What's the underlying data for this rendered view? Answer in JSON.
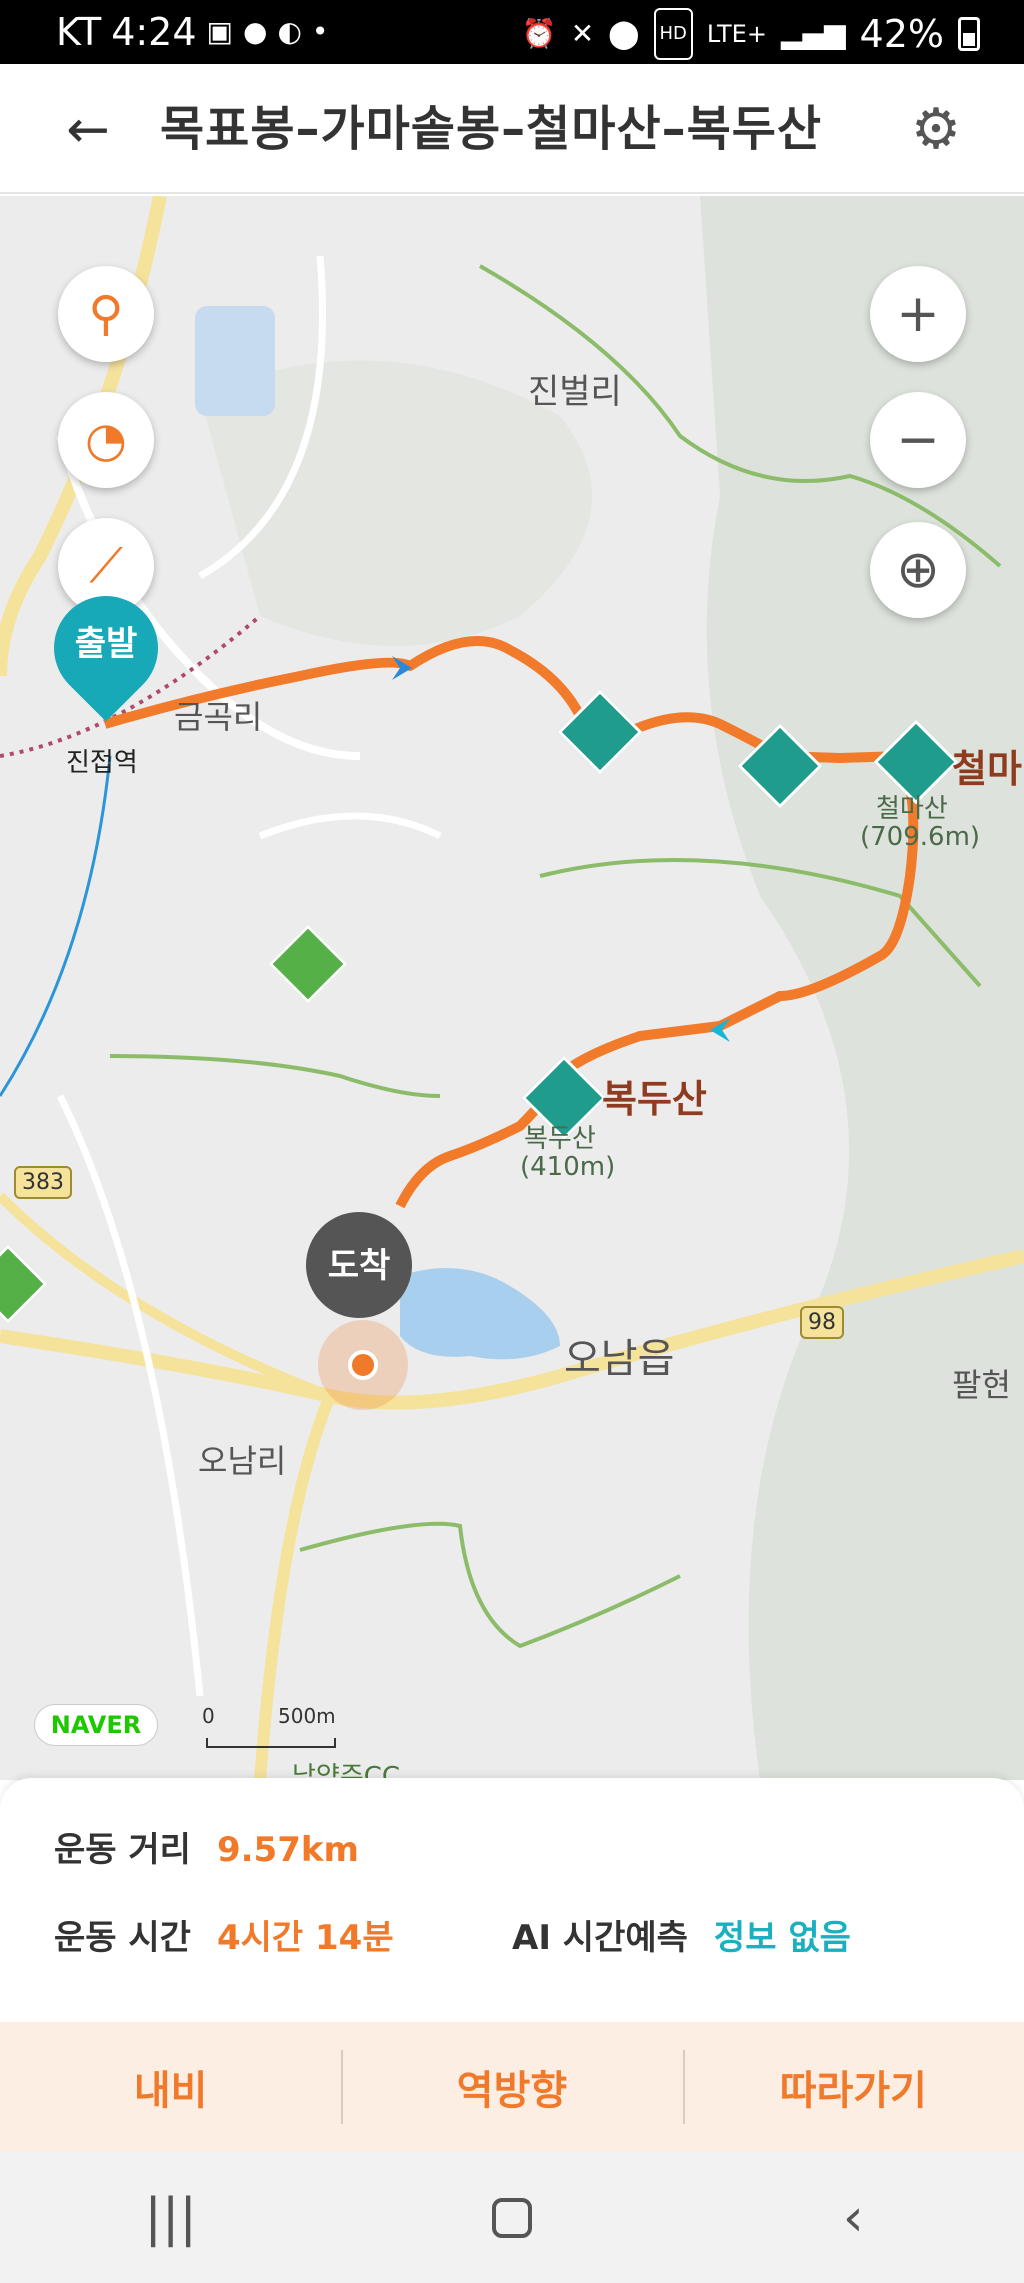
{
  "status_bar": {
    "carrier": "KT",
    "time": "4:24",
    "network": "LTE+",
    "battery_percent": "42%",
    "battery_level": 0.42,
    "left_icons": [
      "image-icon",
      "talk-icon",
      "running-icon",
      "dot-icon"
    ],
    "right_icons": [
      "alarm-icon",
      "mute-icon",
      "location-icon",
      "hd-icon",
      "signal-icon",
      "battery-icon"
    ]
  },
  "header": {
    "title": "목표봉–가마솥봉–철마산–복두산",
    "back_icon": "arrow-left-icon",
    "settings_icon": "gear-icon"
  },
  "map": {
    "left_controls": [
      "location-pin-icon",
      "speedometer-icon",
      "route-slope-icon"
    ],
    "right_controls": {
      "zoom_in": "+",
      "zoom_out": "−",
      "locate_icon": "crosshair-icon"
    },
    "labels": {
      "jinbeolli": "진벌리",
      "geumgokri": "금곡리",
      "jinjeop_station": "진접역",
      "cheolmasan_partial": "철마",
      "cheolmasan_small": "철마산",
      "cheolmasan_height": "(709.6m)",
      "bokdusan": "복두산",
      "bokdusan_small": "복두산",
      "bokdusan_height": "(410m)",
      "onam_eup": "오남읍",
      "onamri": "오남리",
      "palhyeon_partial": "팔현",
      "road_383": "383",
      "road_98": "98",
      "naeyang_cc_partial": "남양주CC"
    },
    "start_pin": "출발",
    "end_pin": "도착",
    "naver_logo": "NAVER",
    "scale": {
      "zero": "0",
      "distance": "500m"
    },
    "route_color": "#f27a2b",
    "trail_color": "#8cbc6a"
  },
  "info": {
    "distance_label": "운동 거리",
    "distance_value": "9.57km",
    "time_label": "운동 시간",
    "time_value": "4시간 14분",
    "ai_label": "AI 시간예측",
    "ai_value": "정보 없음"
  },
  "actions": {
    "navi": "내비",
    "reverse": "역방향",
    "follow": "따라가기"
  },
  "nav_bar": {
    "recent_icon": "recent-apps-icon",
    "home_icon": "home-icon",
    "back_icon": "back-icon"
  },
  "colors": {
    "accent_orange": "#f07a2a",
    "teal": "#17a9b8",
    "action_bg": "#fdeee3"
  }
}
